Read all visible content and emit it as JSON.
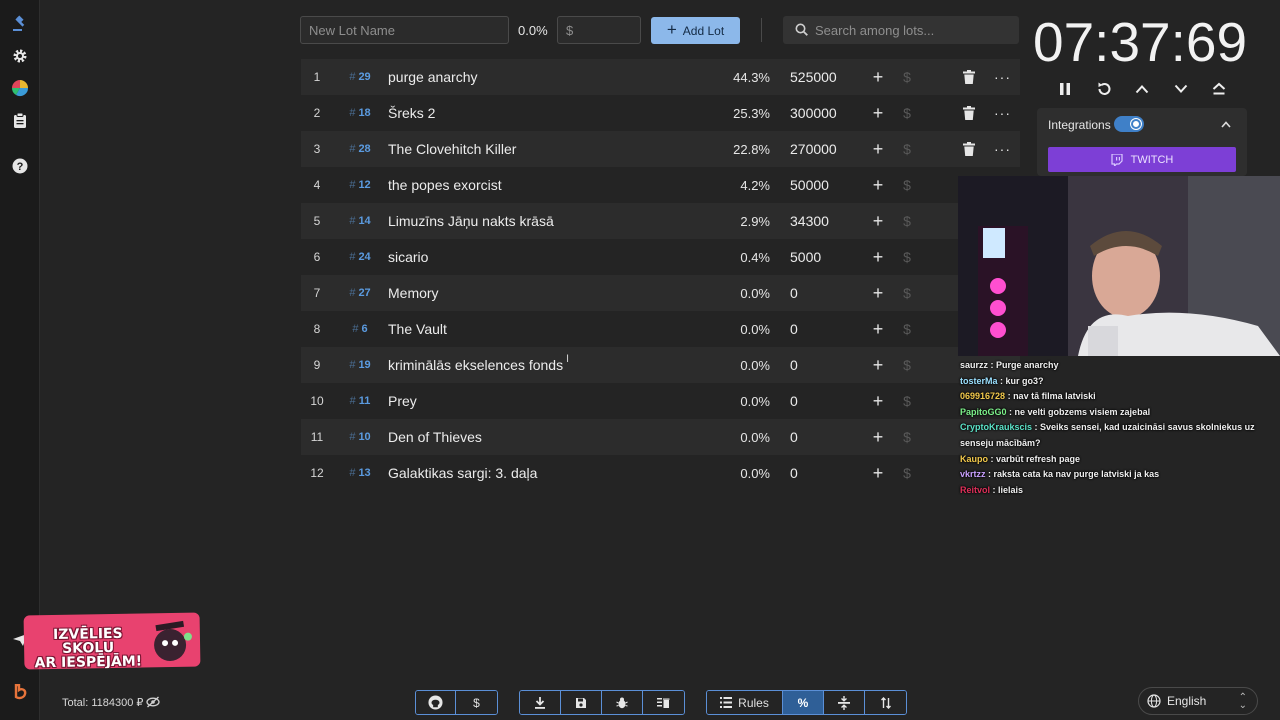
{
  "sidebar": {
    "icons": [
      "gavel-icon",
      "gear-icon",
      "pie-chart-icon",
      "clipboard-icon",
      "help-icon",
      "send-icon",
      "brand-icon"
    ]
  },
  "toolbar": {
    "lot_name_placeholder": "New Lot Name",
    "percent": "0.0%",
    "amount_placeholder": "$",
    "add_lot_label": "Add Lot",
    "search_placeholder": "Search among lots..."
  },
  "lots": [
    {
      "index": "1",
      "id": "29",
      "name": "purge anarchy",
      "percent": "44.3%",
      "amount": "525000"
    },
    {
      "index": "2",
      "id": "18",
      "name": "Šreks 2",
      "percent": "25.3%",
      "amount": "300000"
    },
    {
      "index": "3",
      "id": "28",
      "name": "The Clovehitch Killer",
      "percent": "22.8%",
      "amount": "270000"
    },
    {
      "index": "4",
      "id": "12",
      "name": "the popes exorcist",
      "percent": "4.2%",
      "amount": "50000"
    },
    {
      "index": "5",
      "id": "14",
      "name": "Limuzīns Jāņu nakts krāsā",
      "percent": "2.9%",
      "amount": "34300"
    },
    {
      "index": "6",
      "id": "24",
      "name": "sicario",
      "percent": "0.4%",
      "amount": "5000"
    },
    {
      "index": "7",
      "id": "27",
      "name": "Memory",
      "percent": "0.0%",
      "amount": "0"
    },
    {
      "index": "8",
      "id": "6",
      "name": "The Vault",
      "percent": "0.0%",
      "amount": "0"
    },
    {
      "index": "9",
      "id": "19",
      "name": "kriminālās ekselences fonds",
      "percent": "0.0%",
      "amount": "0"
    },
    {
      "index": "10",
      "id": "11",
      "name": "Prey",
      "percent": "0.0%",
      "amount": "0"
    },
    {
      "index": "11",
      "id": "10",
      "name": "Den of Thieves",
      "percent": "0.0%",
      "amount": "0"
    },
    {
      "index": "12",
      "id": "13",
      "name": "Galaktikas sargi: 3. daļa",
      "percent": "0.0%",
      "amount": "0"
    }
  ],
  "timer": {
    "display": "07:37:69"
  },
  "integrations": {
    "label": "Integrations",
    "enabled": true,
    "twitch_label": "TWITCH"
  },
  "chat": [
    {
      "user": "saurzz",
      "message": "Purge anarchy",
      "color": "#f0f0f0"
    },
    {
      "user": "tosterMa",
      "message": "kur go3?",
      "color": "#9be0ff"
    },
    {
      "user": "069916728",
      "message": "nav tā filma latviski",
      "color": "#f2c94c"
    },
    {
      "user": "PapitoGG0",
      "message": "ne velti gobzems visiem zajebal",
      "color": "#7cf08a"
    },
    {
      "user": "CryptoKraukscis",
      "message": "Sveiks sensei, kad uzaicināsi savus skolniekus uz senseju mācībām?",
      "color": "#5be3c8"
    },
    {
      "user": "Kaupo",
      "message": "varbūt refresh page",
      "color": "#f2c94c"
    },
    {
      "user": "vkrtzz",
      "message": "raksta cata ka nav purge latviski ja kas",
      "color": "#c9a0ff"
    },
    {
      "user": "Reitvol",
      "message": "lielais",
      "color": "#e0305a"
    }
  ],
  "promo": {
    "text_line1": "IZVĒLIES SKOLU",
    "text_line2": "AR IESPĒJĀM!"
  },
  "footer": {
    "total": "Total: 1184300 ₽",
    "rules_label": "Rules",
    "language": "English"
  },
  "colors": {
    "accent": "#5b8fd6",
    "add_button": "#8cb8ea",
    "twitch": "#7d3fd6",
    "id_blue": "#5b9be0"
  }
}
